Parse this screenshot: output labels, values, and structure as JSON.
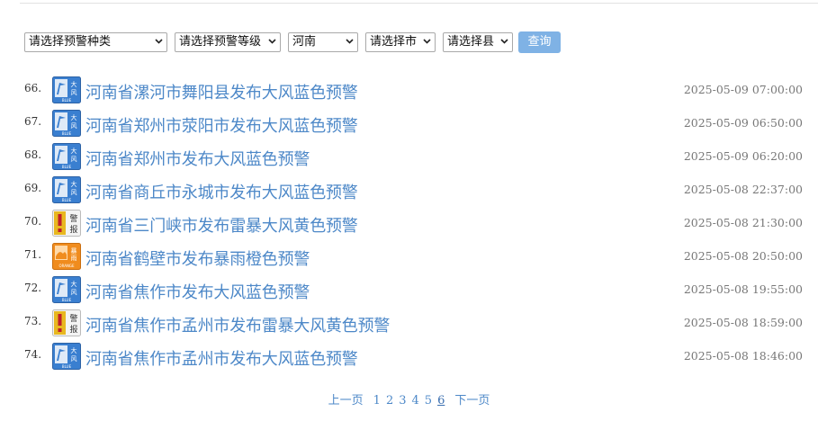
{
  "filters": {
    "kind": "请选择预警种类",
    "level": "请选择预警等级",
    "province": "河南",
    "city": "请选择市",
    "county": "请选择县",
    "query_label": "查询"
  },
  "icon_types": {
    "blue-wind": {
      "bg": "#3a7fd0",
      "text_top": "大",
      "text_mid": "风",
      "caption": "BLUE"
    },
    "yellow-thunder": {
      "bg": "#e8b820",
      "text_top": "警",
      "text_mid": "报"
    },
    "orange-rain": {
      "bg": "#f08c1e",
      "text_top": "暴",
      "text_mid": "雨",
      "caption": "ORANGE"
    }
  },
  "alerts": [
    {
      "num": "66.",
      "icon": "blue-wind",
      "title": "河南省漯河市舞阳县发布大风蓝色预警",
      "time": "2025-05-09 07:00:00"
    },
    {
      "num": "67.",
      "icon": "blue-wind",
      "title": "河南省郑州市荥阳市发布大风蓝色预警",
      "time": "2025-05-09 06:50:00"
    },
    {
      "num": "68.",
      "icon": "blue-wind",
      "title": "河南省郑州市发布大风蓝色预警",
      "time": "2025-05-09 06:20:00"
    },
    {
      "num": "69.",
      "icon": "blue-wind",
      "title": "河南省商丘市永城市发布大风蓝色预警",
      "time": "2025-05-08 22:37:00"
    },
    {
      "num": "70.",
      "icon": "yellow-thunder",
      "title": "河南省三门峡市发布雷暴大风黄色预警",
      "time": "2025-05-08 21:30:00"
    },
    {
      "num": "71.",
      "icon": "orange-rain",
      "title": "河南省鹤壁市发布暴雨橙色预警",
      "time": "2025-05-08 20:50:00"
    },
    {
      "num": "72.",
      "icon": "blue-wind",
      "title": "河南省焦作市发布大风蓝色预警",
      "time": "2025-05-08 19:55:00"
    },
    {
      "num": "73.",
      "icon": "yellow-thunder",
      "title": "河南省焦作市孟州市发布雷暴大风黄色预警",
      "time": "2025-05-08 18:59:00"
    },
    {
      "num": "74.",
      "icon": "blue-wind",
      "title": "河南省焦作市孟州市发布大风蓝色预警",
      "time": "2025-05-08 18:46:00"
    }
  ],
  "pagination": {
    "prev": "上一页",
    "pages": [
      "1",
      "2",
      "3",
      "4",
      "5",
      "6"
    ],
    "current": "6",
    "next": "下一页"
  }
}
